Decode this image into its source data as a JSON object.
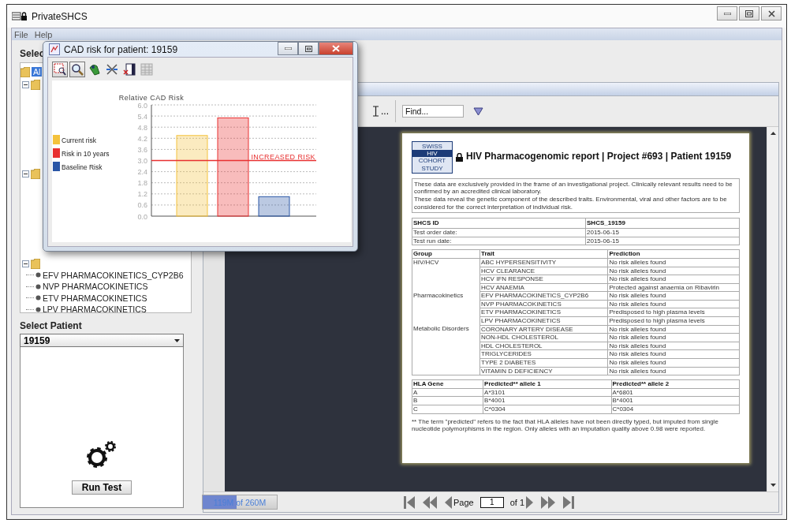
{
  "window": {
    "title": "PrivateSHCS"
  },
  "menu": [
    "File",
    "Help"
  ],
  "sidebar": {
    "heading": "Selec",
    "tree": {
      "root": {
        "label": "Al",
        "selected": true
      },
      "groups": [
        {
          "expanded": true
        },
        {
          "expanded": true
        },
        {
          "expanded": true,
          "children": [
            "EFV PHARMACOKINETICS_CYP2B6",
            "NVP PHARMACOKINETICS",
            "ETV PHARMACOKINETICS",
            "LPV PHARMACOKINETICS"
          ]
        }
      ]
    },
    "patient_heading": "Select Patient",
    "patient_select": {
      "value": "19159"
    },
    "run_button": "Run Test"
  },
  "viewer": {
    "toolbar_overflow": "...",
    "find": {
      "placeholder": "Find..."
    },
    "report": {
      "logo": [
        "SWISS",
        "HIV",
        "COHORT",
        "STUDY"
      ],
      "title": "HIV Pharmacogenomic report | Project #693 | Patient 19159",
      "disclaimer": [
        "These data are exclusively provided in the frame of an investigational project. Clinically relevant results need to be confirmed by an accredited clinical laboratory.",
        "These data reveal the genetic component of the described traits. Environmental, viral and other factors are to be considered for the correct interpretation of individual risk."
      ],
      "info": [
        [
          "SHCS ID",
          "SHCS_19159"
        ],
        [
          "Test order date:",
          "2015-06-15"
        ],
        [
          "Test run date:",
          "2015-06-15"
        ]
      ],
      "traits_columns": [
        "Group",
        "Trait",
        "Prediction"
      ],
      "trait_groups": [
        {
          "name": "HIV/HCV",
          "rows": [
            [
              "ABC HYPERSENSITIVITY",
              "No risk alleles found"
            ],
            [
              "HCV CLEARANCE",
              "No risk alleles found"
            ],
            [
              "HCV IFN RESPONSE",
              "No risk alleles found"
            ],
            [
              "HCV ANAEMIA",
              "Protected against anaemia on Ribavirin"
            ]
          ]
        },
        {
          "name": "Pharmacokinetics",
          "rows": [
            [
              "EFV PHARMACOKINETICS_CYP2B6",
              "No risk alleles found"
            ],
            [
              "NVP PHARMACOKINETICS",
              "No risk alleles found"
            ],
            [
              "ETV PHARMACOKINETICS",
              "Predisposed to high plasma levels"
            ],
            [
              "LPV PHARMACOKINETICS",
              "Predisposed to high plasma levels"
            ]
          ]
        },
        {
          "name": "Metabolic Disorders",
          "rows": [
            [
              "CORONARY ARTERY DISEASE",
              "No risk alleles found"
            ],
            [
              "NON-HDL CHOLESTEROL",
              "No risk alleles found"
            ],
            [
              "HDL CHOLESTEROL",
              "No risk alleles found"
            ],
            [
              "TRIGLYCERIDES",
              "No risk alleles found"
            ],
            [
              "TYPE 2 DIABETES",
              "No risk alleles found"
            ],
            [
              "VITAMIN D DEFICIENCY",
              "No risk alleles found"
            ]
          ]
        }
      ],
      "hla_columns": [
        "HLA Gene",
        "Predicted** allele 1",
        "Predicted** allele 2"
      ],
      "hla_rows": [
        [
          "A",
          "A*3101",
          "A*6801"
        ],
        [
          "B",
          "B*4001",
          "B*4001"
        ],
        [
          "C",
          "C*0304",
          "C*0304"
        ]
      ],
      "footnote": "** The term \"predicted\" refers to the fact that HLA alleles have not been directly typed, but imputed from single nucleotide polymorphisms in the region. Only alleles with an imputation quality above 0.98 were reported."
    },
    "memory": {
      "label": "119M of 260M",
      "level": 0.458
    },
    "pager": {
      "label": "Page",
      "page": "1",
      "total": "of 1"
    }
  },
  "dialog": {
    "title": "CAD risk for patient: 19159",
    "tools": [
      {
        "kind": "zoom-box",
        "selected": true
      },
      {
        "kind": "zoom",
        "selected": true
      },
      {
        "kind": "pan",
        "selected": false
      },
      {
        "kind": "arrows",
        "selected": false
      },
      {
        "kind": "export",
        "selected": false
      },
      {
        "kind": "table",
        "selected": false
      }
    ],
    "chart_data": {
      "type": "bar",
      "ylabel": "Relative CAD Risk",
      "ylim": [
        0,
        6
      ],
      "yticks": [
        {
          "value": 0,
          "label": "0.0"
        },
        {
          "value": 0.6,
          "label": "0.6"
        },
        {
          "value": 1.2,
          "label": "1.2"
        },
        {
          "value": 1.8,
          "label": "1.8"
        },
        {
          "value": 2.4,
          "label": "2.4"
        },
        {
          "value": 3.0,
          "label": "3.0"
        },
        {
          "value": 3.6,
          "label": "3.6"
        },
        {
          "value": 4.2,
          "label": "4.2"
        },
        {
          "value": 4.8,
          "label": "4.8"
        },
        {
          "value": 5.4,
          "label": "5.4"
        },
        {
          "value": 6.0,
          "label": "6.0"
        }
      ],
      "series": [
        {
          "name": "Current risk",
          "color": "#f4c23c",
          "values": [
            4.35,
            null,
            null
          ]
        },
        {
          "name": "Risk in 10 years",
          "color": "#e83030",
          "values": [
            null,
            5.3,
            null
          ]
        },
        {
          "name": "Baseline Risk",
          "color": "#2a56a6",
          "values": [
            null,
            null,
            1.05
          ]
        }
      ],
      "grid": true,
      "legend": "left",
      "ref_lines": [
        {
          "axis": "y",
          "value": 3.0,
          "label": "INCREASED RISK",
          "color": "#e83030"
        }
      ]
    }
  }
}
